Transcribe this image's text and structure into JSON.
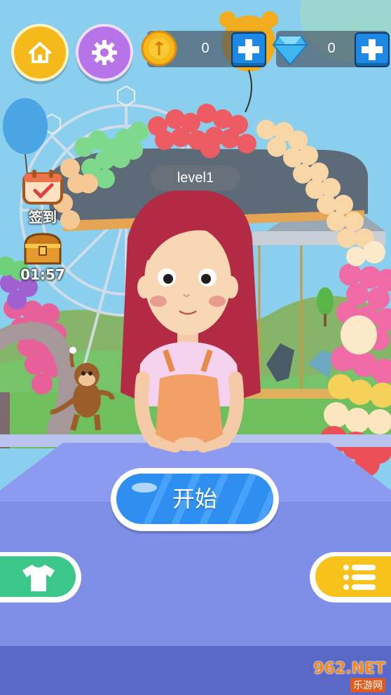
{
  "hud": {
    "coins": "0",
    "gems": "0"
  },
  "side": {
    "checkin_label": "签到",
    "chest_timer": "01:57"
  },
  "level": {
    "label": "level1"
  },
  "start_button": {
    "label": "开始"
  },
  "watermark": {
    "brand": "962.NET",
    "sub": "乐游网"
  },
  "colors": {
    "sky": "#8ad0ee",
    "table": "#7f8ee6",
    "start_blue": "#2e8ff0",
    "coin": "#f6b91b",
    "settings_purple": "#b773e8",
    "wardrobe_green": "#3cc78a",
    "list_yellow": "#f7c21c",
    "hair": "#b32a45"
  },
  "icons": {
    "home": "home-icon",
    "settings": "gear-icon",
    "coin": "coin-icon",
    "gem": "diamond-icon",
    "plus": "plus-icon",
    "checkin": "calendar-check-icon",
    "chest": "treasure-chest-icon",
    "wardrobe": "tshirt-icon",
    "list": "list-icon"
  }
}
